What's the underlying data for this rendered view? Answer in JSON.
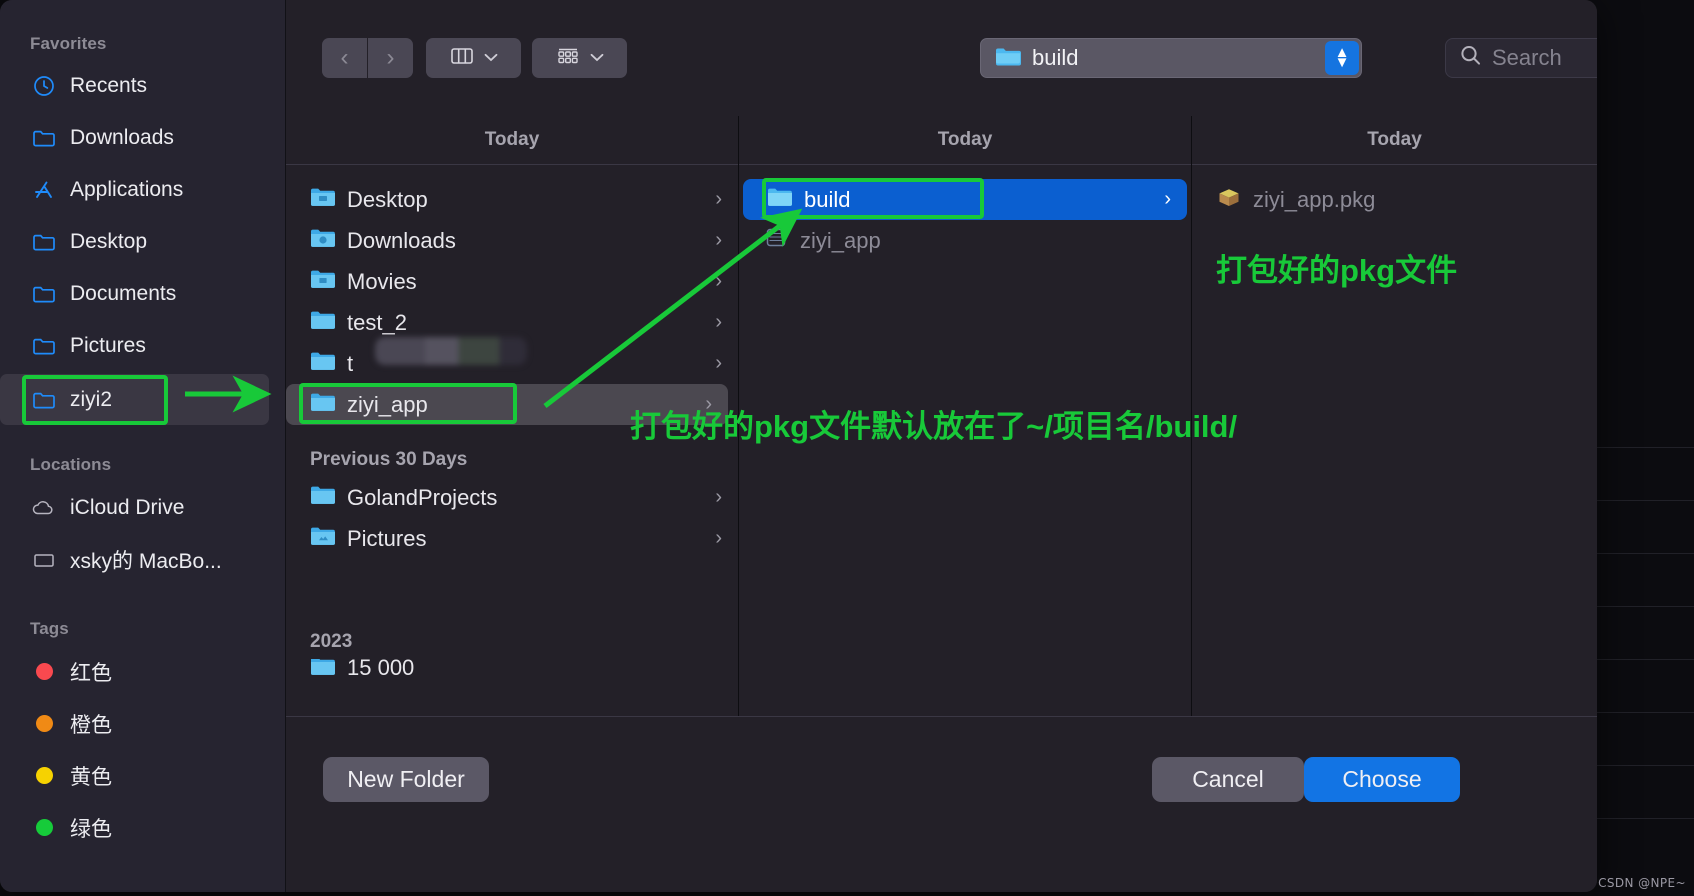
{
  "window": {
    "title": "file-chooser-dialog"
  },
  "sidebar": {
    "sections": [
      {
        "header": "Favorites",
        "items": [
          {
            "label": "Recents",
            "icon": "clock-icon"
          },
          {
            "label": "Downloads",
            "icon": "folder-icon"
          },
          {
            "label": "Applications",
            "icon": "applications-icon"
          },
          {
            "label": "Desktop",
            "icon": "folder-icon"
          },
          {
            "label": "Documents",
            "icon": "folder-icon"
          },
          {
            "label": "Pictures",
            "icon": "folder-icon"
          },
          {
            "label": "ziyi2",
            "icon": "folder-icon",
            "selected": true
          }
        ]
      },
      {
        "header": "Locations",
        "items": [
          {
            "label": "iCloud Drive",
            "icon": "cloud-icon"
          },
          {
            "label": "xsky的 MacBo...",
            "icon": "laptop-icon"
          }
        ]
      },
      {
        "header": "Tags",
        "items": [
          {
            "label": "红色",
            "icon": "tag-dot-icon",
            "color": "#f9494f"
          },
          {
            "label": "橙色",
            "icon": "tag-dot-icon",
            "color": "#f08a15"
          },
          {
            "label": "黄色",
            "icon": "tag-dot-icon",
            "color": "#f6d201"
          },
          {
            "label": "绿色",
            "icon": "tag-dot-icon",
            "color": "#16cb3a"
          }
        ]
      }
    ]
  },
  "toolbar": {
    "back_label": "‹",
    "forward_label": "›",
    "view_columns_label": "columns-view",
    "view_icon_label": "icon-view",
    "path": {
      "label": "build",
      "icon": "folder-icon"
    },
    "search": {
      "placeholder": "Search",
      "value": ""
    }
  },
  "columns": [
    {
      "header": "Today",
      "rows": [
        {
          "label": "Desktop",
          "icon": "folder-desktop-icon",
          "chevron": "›",
          "state": "normal"
        },
        {
          "label": "Downloads",
          "icon": "folder-downloads-icon",
          "chevron": "›",
          "state": "normal"
        },
        {
          "label": "Movies",
          "icon": "folder-movies-icon",
          "chevron": "›",
          "state": "normal"
        },
        {
          "label": "test_2",
          "icon": "folder-icon",
          "chevron": "›",
          "state": "normal"
        },
        {
          "label": "t",
          "icon": "folder-icon",
          "chevron": "›",
          "state": "redacted"
        },
        {
          "label": "ziyi_app",
          "icon": "folder-icon",
          "chevron": "›",
          "state": "highlighted"
        }
      ],
      "group2_header": "Previous 30 Days",
      "rows2": [
        {
          "label": "GolandProjects",
          "icon": "folder-icon",
          "chevron": "›",
          "state": "normal"
        },
        {
          "label": "Pictures",
          "icon": "folder-pictures-icon",
          "chevron": "›",
          "state": "normal"
        }
      ],
      "group3_header": "2023",
      "rows3": [
        {
          "label": "15 000",
          "icon": "folder-icon",
          "chevron": "",
          "state": "clipped"
        }
      ]
    },
    {
      "header": "Today",
      "rows": [
        {
          "label": "build",
          "icon": "folder-icon",
          "chevron": "›",
          "state": "selected"
        },
        {
          "label": "ziyi_app",
          "icon": "app-icon",
          "chevron": "",
          "state": "dim"
        }
      ]
    },
    {
      "header": "Today",
      "rows": [
        {
          "label": "ziyi_app.pkg",
          "icon": "package-icon",
          "chevron": "",
          "state": "dim"
        }
      ]
    }
  ],
  "footer": {
    "new_folder_label": "New Folder",
    "cancel_label": "Cancel",
    "choose_label": "Choose"
  },
  "annotations": {
    "color": "#18c939",
    "note_pkg": "打包好的pkg文件",
    "note_path": "打包好的pkg文件默认放在了~/项目名/build/"
  },
  "watermark": {
    "text": "CSDN @NPE~"
  },
  "colors": {
    "accent_blue": "#0b5fd0",
    "annotation_green": "#18c939",
    "window_bg": "#232028",
    "sidebar_bg": "#262430"
  }
}
